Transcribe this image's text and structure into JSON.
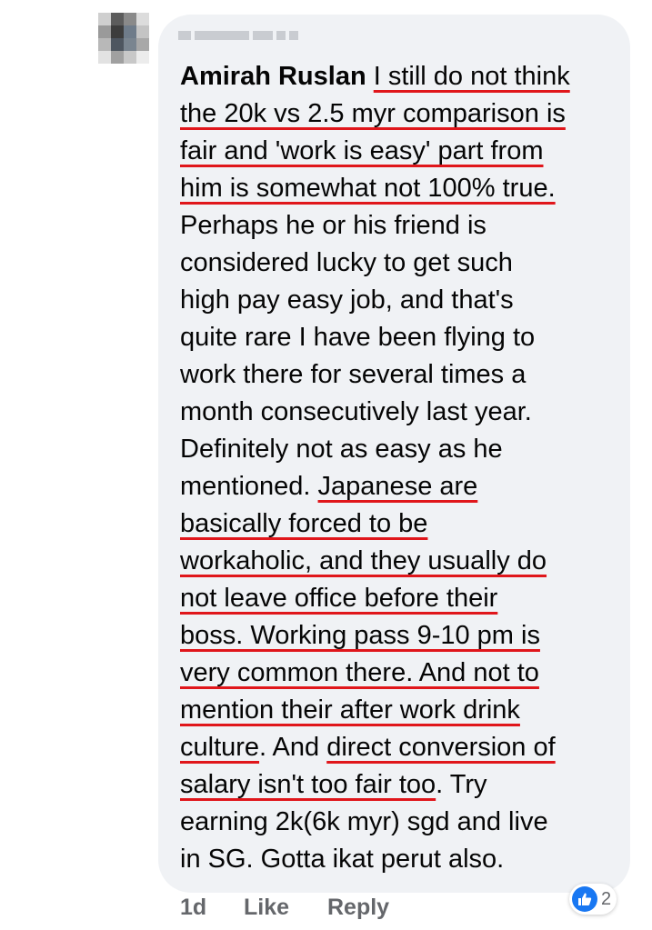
{
  "comment": {
    "author": "Amirah Ruslan",
    "lines": [
      [
        {
          "t": "Amirah Ruslan",
          "s": "author"
        },
        {
          "t": " ",
          "s": ""
        },
        {
          "t": "I still do not think",
          "s": "ul"
        }
      ],
      [
        {
          "t": "the 20k vs 2.5 myr comparison is",
          "s": "ul"
        }
      ],
      [
        {
          "t": "fair and 'work is easy' part from",
          "s": "ul"
        }
      ],
      [
        {
          "t": "him is somewhat not 100% true.",
          "s": "ul"
        }
      ],
      [
        {
          "t": "Perhaps he or his friend is",
          "s": ""
        }
      ],
      [
        {
          "t": "considered lucky to get such",
          "s": ""
        }
      ],
      [
        {
          "t": "high pay easy job, and that's",
          "s": ""
        }
      ],
      [
        {
          "t": "quite rare  I have been flying to",
          "s": ""
        }
      ],
      [
        {
          "t": "work there for several times a",
          "s": ""
        }
      ],
      [
        {
          "t": "month consecutively last year.",
          "s": ""
        }
      ],
      [
        {
          "t": "Definitely not as easy as he",
          "s": ""
        }
      ],
      [
        {
          "t": "mentioned. ",
          "s": ""
        },
        {
          "t": "Japanese are",
          "s": "ul"
        }
      ],
      [
        {
          "t": "basically forced to be",
          "s": "ul"
        }
      ],
      [
        {
          "t": "workaholic, and they usually do",
          "s": "ul"
        }
      ],
      [
        {
          "t": "not leave office before their",
          "s": "ul"
        }
      ],
      [
        {
          "t": "boss. Working pass 9-10 pm is",
          "s": "ul"
        }
      ],
      [
        {
          "t": "very common there. And not to",
          "s": "ul"
        }
      ],
      [
        {
          "t": "mention their after work drink",
          "s": "ul"
        }
      ],
      [
        {
          "t": "culture",
          "s": "ul"
        },
        {
          "t": ". And ",
          "s": ""
        },
        {
          "t": "direct conversion of",
          "s": "ul"
        }
      ],
      [
        {
          "t": "salary isn't too fair too",
          "s": "ul"
        },
        {
          "t": ". Try",
          "s": ""
        }
      ],
      [
        {
          "t": "earning 2k(6k myr) sgd and live",
          "s": ""
        }
      ],
      [
        {
          "t": "in SG. Gotta ikat perut also.",
          "s": ""
        }
      ]
    ]
  },
  "actions": {
    "time": "1d",
    "like": "Like",
    "reply": "Reply"
  },
  "reactions": {
    "icon": "thumbs-up-icon",
    "count": "2"
  },
  "colors": {
    "bubble": "#f0f2f5",
    "text": "#050505",
    "meta": "#65676b",
    "underline": "#e0161b",
    "like_blue": "#1877f2"
  },
  "avatar_pixels": [
    "#cfcfcf",
    "#5c5c5c",
    "#8a8a8a",
    "#dcdcdc",
    "#9a9a9a",
    "#3d3d3d",
    "#6f7c8a",
    "#c4c4c4",
    "#b8b8b8",
    "#4e5660",
    "#7a8590",
    "#a8a8a8",
    "#e2e2e2",
    "#a0a0a0",
    "#c8c8c8",
    "#ececec"
  ]
}
